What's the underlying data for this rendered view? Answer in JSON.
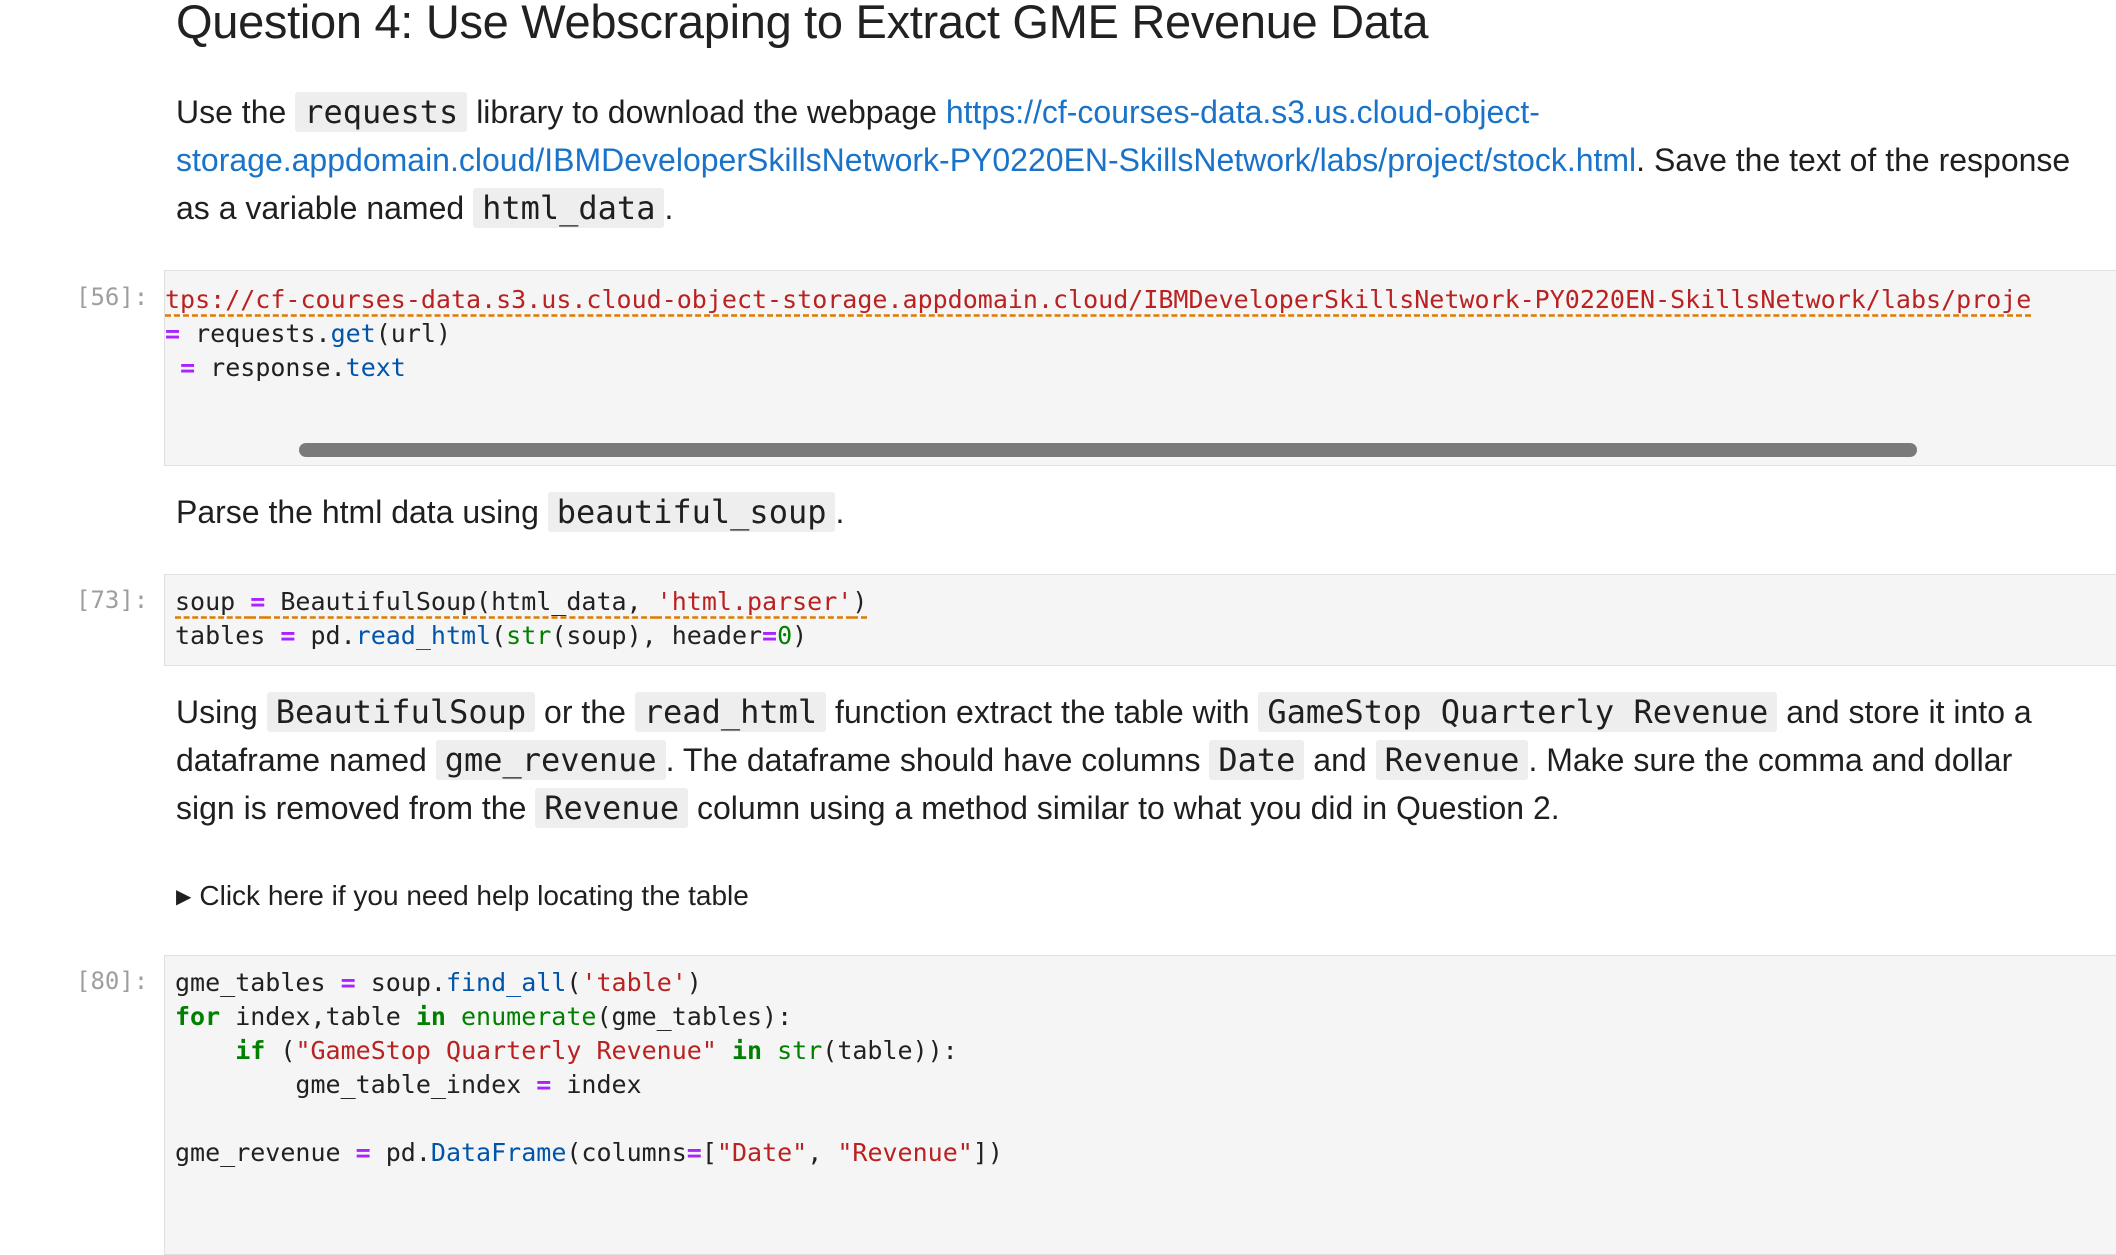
{
  "heading": "Question 4: Use Webscraping to Extract GME Revenue Data",
  "para1": {
    "t1": "Use the ",
    "code1": "requests",
    "t2": " library to download the webpage ",
    "link": "https://cf-courses-data.s3.us.cloud-object-storage.appdomain.cloud/IBMDeveloperSkillsNetwork-PY0220EN-SkillsNetwork/labs/project/stock.html",
    "t3": ". Save the text of the response as a variable named ",
    "code2": "html_data",
    "t4": "."
  },
  "cell56": {
    "prompt": "[56]:",
    "line1": "tps://cf-courses-data.s3.us.cloud-object-storage.appdomain.cloud/IBMDeveloperSkillsNetwork-PY0220EN-SkillsNetwork/labs/proje",
    "line2": {
      "op": "=",
      "a": " requests.",
      "fn": "get",
      "b": "(url)"
    },
    "line3": {
      "pre": " ",
      "op": "=",
      "a": " response.",
      "fn": "text"
    }
  },
  "para2": {
    "t1": "Parse the html data using ",
    "code1": "beautiful_soup",
    "t2": "."
  },
  "cell73": {
    "prompt": "[73]:",
    "line1": {
      "a": "soup ",
      "op": "=",
      "b": " BeautifulSoup(html_data, ",
      "st": "'html.parser'",
      "c": ")"
    },
    "line2": {
      "a": "tables ",
      "op": "=",
      "b": " pd.",
      "fn": "read_html",
      "c": "(",
      "bi": "str",
      "d": "(soup), header",
      "op2": "=",
      "nm": "0",
      "e": ")"
    }
  },
  "para3": {
    "t1": "Using ",
    "c1": "BeautifulSoup",
    "t2": " or the ",
    "c2": "read_html",
    "t3": " function extract the table with ",
    "c3": "GameStop Quarterly Revenue",
    "t4": " and store it into a dataframe named ",
    "c4": "gme_revenue",
    "t5": ". The dataframe should have columns ",
    "c5": "Date",
    "t6": " and ",
    "c6": "Revenue",
    "t7": ". Make sure the comma and dollar sign is removed from the ",
    "c7": "Revenue",
    "t8": " column using a method similar to what you did in Question 2."
  },
  "details": {
    "marker": "▶",
    "label": "Click here if you need help locating the table"
  },
  "cell80": {
    "prompt": "[80]:",
    "l1": {
      "a": "gme_tables ",
      "op": "=",
      "b": " soup.",
      "fn": "find_all",
      "c": "(",
      "st": "'table'",
      "d": ")"
    },
    "l2": {
      "kw": "for",
      "a": " index,table ",
      "kw2": "in",
      "b": " ",
      "bi": "enumerate",
      "c": "(gme_tables):"
    },
    "l3": {
      "pre": "    ",
      "kw": "if",
      "a": " (",
      "st": "\"GameStop Quarterly Revenue\"",
      "b": " ",
      "kw2": "in",
      "c": " ",
      "bi": "str",
      "d": "(table)):"
    },
    "l4": {
      "pre": "        gme_table_index ",
      "op": "=",
      "a": " index"
    },
    "l6": {
      "a": "gme_revenue ",
      "op": "=",
      "b": " pd.",
      "fn": "DataFrame",
      "c": "(columns",
      "op2": "=",
      "d": "[",
      "st": "\"Date\"",
      "e": ", ",
      "st2": "\"Revenue\"",
      "f": "])"
    }
  }
}
